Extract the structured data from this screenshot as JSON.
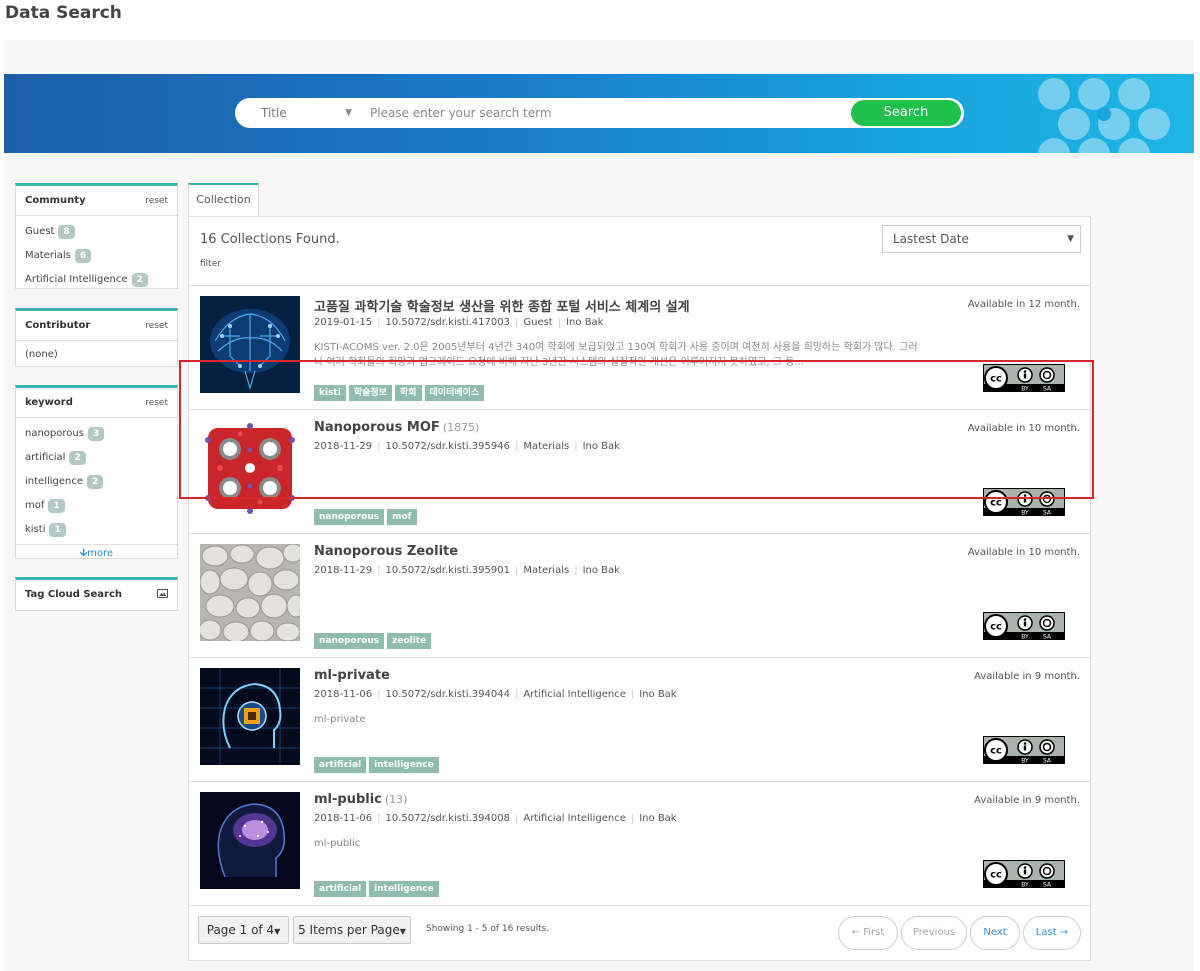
{
  "page_title": "Data Search",
  "search": {
    "field": "Title",
    "placeholder": "Please enter your search term",
    "button": "Search"
  },
  "facets": {
    "community": {
      "title": "Communty",
      "reset": "reset",
      "items": [
        {
          "label": "Guest",
          "count": "8"
        },
        {
          "label": "Materials",
          "count": "6"
        },
        {
          "label": "Artificial Intelligence",
          "count": "2"
        }
      ]
    },
    "contributor": {
      "title": "Contributor",
      "reset": "reset",
      "items": [
        {
          "label": "(none)"
        }
      ]
    },
    "keyword": {
      "title": "keyword",
      "reset": "reset",
      "items": [
        {
          "label": "nanoporous",
          "count": "3"
        },
        {
          "label": "artificial",
          "count": "2"
        },
        {
          "label": "intelligence",
          "count": "2"
        },
        {
          "label": "mof",
          "count": "1"
        },
        {
          "label": "kisti",
          "count": "1"
        }
      ],
      "more": "more"
    },
    "tag_cloud": {
      "title": "Tag Cloud Search"
    }
  },
  "tab": "Collection",
  "results": {
    "found": "16 Collections Found.",
    "filter": "filter",
    "sort": "Lastest Date",
    "items": [
      {
        "title": "고품질 과학기술 학술정보 생산을 위한 종합 포털 서비스 체계의 설계",
        "count": "",
        "date": "2019-01-15",
        "doi": "10.5072/sdr.kisti.417003",
        "community": "Guest",
        "author": "Ino Bak",
        "desc": "KISTI-ACOMS ver. 2.0은 2005년부터 4년간 340여 학회에 보급되었고 130여 학회가 사용 중이며 여전히 사용을 희망하는 학회가 많다. 그러나 여러 학회들의 희망과 업그레이드 요청에 비해 지난 3년간 시스템의 실질적인 개선은 이루어지지 못하였고, 그 동...",
        "tags": [
          "kisti",
          "학술정보",
          "학회",
          "데이터베이스"
        ],
        "available": "Available in 12 month."
      },
      {
        "title": "Nanoporous MOF",
        "count": "(1875)",
        "date": "2018-11-29",
        "doi": "10.5072/sdr.kisti.395946",
        "community": "Materials",
        "author": "Ino Bak",
        "desc": "",
        "tags": [
          "nanoporous",
          "mof"
        ],
        "available": "Available in 10 month."
      },
      {
        "title": "Nanoporous Zeolite",
        "count": "",
        "date": "2018-11-29",
        "doi": "10.5072/sdr.kisti.395901",
        "community": "Materials",
        "author": "Ino Bak",
        "desc": "",
        "tags": [
          "nanoporous",
          "zeolite"
        ],
        "available": "Available in 10 month."
      },
      {
        "title": "ml-private",
        "count": "",
        "date": "2018-11-06",
        "doi": "10.5072/sdr.kisti.394044",
        "community": "Artificial Intelligence",
        "author": "Ino Bak",
        "desc": "ml-private",
        "tags": [
          "artificial",
          "intelligence"
        ],
        "available": "Available in 9 month."
      },
      {
        "title": "ml-public",
        "count": "(13)",
        "date": "2018-11-06",
        "doi": "10.5072/sdr.kisti.394008",
        "community": "Artificial Intelligence",
        "author": "Ino Bak",
        "desc": "ml-public",
        "tags": [
          "artificial",
          "intelligence"
        ],
        "available": "Available in 9 month."
      }
    ]
  },
  "license": {
    "cc": "cc",
    "by": "BY",
    "sa": "SA"
  },
  "pager": {
    "page": "Page 1 of 4",
    "per_page": "5 Items per Page",
    "showing": "Showing 1 - 5 of 16 results.",
    "first": "← First",
    "previous": "Previous",
    "next": "Next",
    "last": "Last →"
  },
  "colors": {
    "accent": "#3bb3a8",
    "search_button": "#1ec14a",
    "tag": "#8fbcaf",
    "highlight": "#d8262b",
    "link": "#2a8fd1"
  }
}
